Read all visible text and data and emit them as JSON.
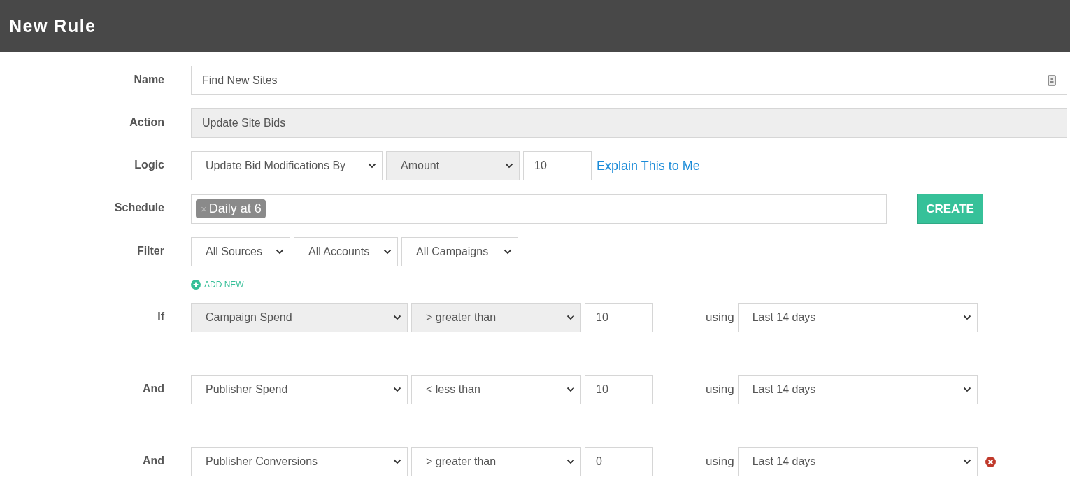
{
  "header": {
    "title": "New Rule"
  },
  "name": {
    "label": "Name",
    "value": "Find New Sites"
  },
  "action": {
    "label": "Action",
    "value": "Update Site Bids",
    "disabled": true
  },
  "logic": {
    "label": "Logic",
    "selects": [
      {
        "value": "Update Bid Modifications By",
        "disabled": false
      },
      {
        "value": "Amount",
        "disabled": true
      }
    ],
    "amount": "10",
    "help_link": "Explain This to Me"
  },
  "schedule": {
    "label": "Schedule",
    "tags": [
      {
        "remove": "×",
        "text": "Daily at 6"
      }
    ],
    "create_button": "CREATE"
  },
  "filter": {
    "label": "Filter",
    "selects": [
      "All Sources",
      "All Accounts",
      "All Campaigns"
    ]
  },
  "add_new": "ADD NEW",
  "conditions": [
    {
      "label": "If",
      "metric": "Campaign Spend",
      "operator": "> greater than",
      "value": "10",
      "using": "using",
      "range": "Last 14 days",
      "disabled": true,
      "removable": false
    },
    {
      "label": "And",
      "metric": "Publisher Spend",
      "operator": "< less than",
      "value": "10",
      "using": "using",
      "range": "Last 14 days",
      "disabled": false,
      "removable": false
    },
    {
      "label": "And",
      "metric": "Publisher Conversions",
      "operator": "> greater than",
      "value": "0",
      "using": "using",
      "range": "Last 14 days",
      "disabled": false,
      "removable": true
    }
  ]
}
